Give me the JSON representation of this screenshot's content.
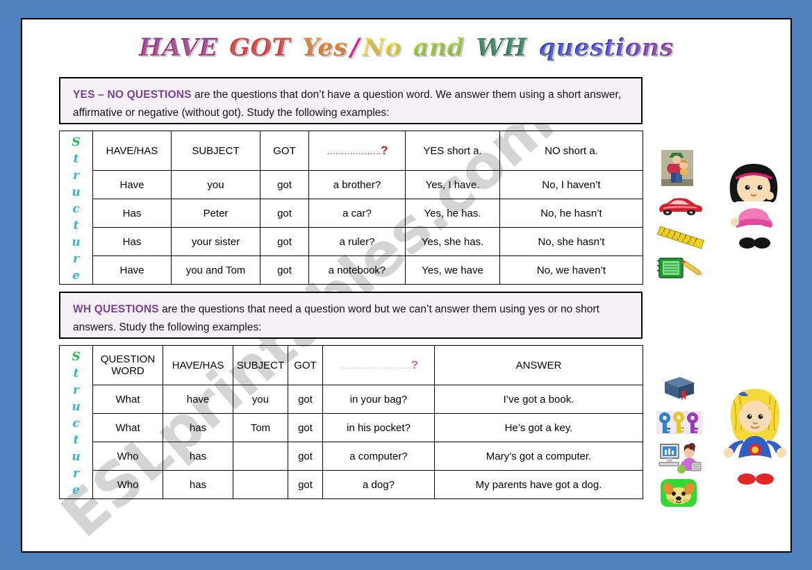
{
  "title": {
    "words": [
      {
        "text": "HAVE",
        "color": "#a0228e"
      },
      {
        "text": "GOT",
        "color": "#e8402a"
      },
      {
        "text": "Yes",
        "color": "#f0912a"
      },
      {
        "text": "/",
        "color": "#d6208a"
      },
      {
        "text": "No",
        "color": "#f5c81a"
      },
      {
        "text": "and",
        "color": "#8cc22a"
      },
      {
        "text": "WH",
        "color": "#1c6e4c"
      },
      {
        "text": "questions",
        "color": "#3a3fd8"
      }
    ],
    "full_text": "HAVE GOT Yes/No and WH questions"
  },
  "intro_yesno": {
    "lead": "YES – NO QUESTIONS",
    "body": " are the questions that don’t have a question word. We answer them using a short answer, affirmative or negative (without got). Study the following examples:"
  },
  "intro_wh": {
    "lead": "WH QUESTIONS",
    "body": " are the questions that need a question word but we can’t answer them using yes or no short answers. Study the following examples:"
  },
  "structure_label": "Structure",
  "table_yesno": {
    "headers": [
      {
        "label": "HAVE/HAS",
        "color": "#1a7a3a"
      },
      {
        "label": "SUBJECT",
        "color": "#2ed94e"
      },
      {
        "label": "GOT",
        "color": "#e8c020"
      },
      {
        "label": "……………….?",
        "color": "#c01818"
      },
      {
        "label": "YES short a.",
        "color": "#f06ad0"
      },
      {
        "label": "NO short a.",
        "color": "#2f7fd0"
      }
    ],
    "rows": [
      [
        "Have",
        "you",
        "got",
        "a brother?",
        "Yes, I have.",
        "No, I haven’t"
      ],
      [
        "Has",
        "Peter",
        "got",
        "a car?",
        "Yes, he has.",
        "No, he hasn’t"
      ],
      [
        "Has",
        "your sister",
        "got",
        "a ruler?",
        "Yes, she has.",
        "No, she hasn’t"
      ],
      [
        "Have",
        "you and Tom",
        "got",
        "a notebook?",
        "Yes, we have",
        "No, we haven’t"
      ]
    ]
  },
  "table_wh": {
    "headers": [
      {
        "label": "QUESTION WORD",
        "color": "#1a7a3a"
      },
      {
        "label": "HAVE/HAS",
        "color": "#2ed94e"
      },
      {
        "label": "SUBJECT",
        "color": "#e8c020"
      },
      {
        "label": "GOT",
        "color": "#a8101c"
      },
      {
        "label": "…………………….?",
        "color": "#f0a8d8"
      },
      {
        "label": "ANSWER",
        "color": "#2f7fd0"
      }
    ],
    "rows": [
      [
        "What",
        "have",
        "you",
        "got",
        "in your bag?",
        "I’ve got a book."
      ],
      [
        "What",
        "has",
        "Tom",
        "got",
        "in his pocket?",
        "He’s got a key."
      ],
      [
        "Who",
        "has",
        "",
        "got",
        "a computer?",
        "Mary’s got a computer."
      ],
      [
        "Who",
        "has",
        "",
        "got",
        "a dog?",
        "My parents have got a dog."
      ]
    ]
  },
  "clipart_yesno": [
    {
      "name": "man-holding-baby-image",
      "alt": "brother"
    },
    {
      "name": "red-car-image",
      "alt": "car"
    },
    {
      "name": "yellow-ruler-image",
      "alt": "ruler"
    },
    {
      "name": "green-notebook-image",
      "alt": "notebook"
    },
    {
      "name": "girl-dark-hair-pink-dress-image",
      "alt": "girl character"
    }
  ],
  "clipart_wh": [
    {
      "name": "blue-book-image",
      "alt": "book"
    },
    {
      "name": "colored-keys-image",
      "alt": "keys"
    },
    {
      "name": "person-at-computer-image",
      "alt": "computer"
    },
    {
      "name": "dog-image",
      "alt": "dog"
    },
    {
      "name": "girl-blonde-blue-dress-image",
      "alt": "girl character"
    }
  ],
  "watermark": {
    "text": "ESLprintables.com"
  },
  "colors": {
    "page_border": "#4f81bd",
    "paper": "#ffffff",
    "intro_box_bg": "#f7f2f7",
    "intro_lead": "#7b3f99"
  }
}
